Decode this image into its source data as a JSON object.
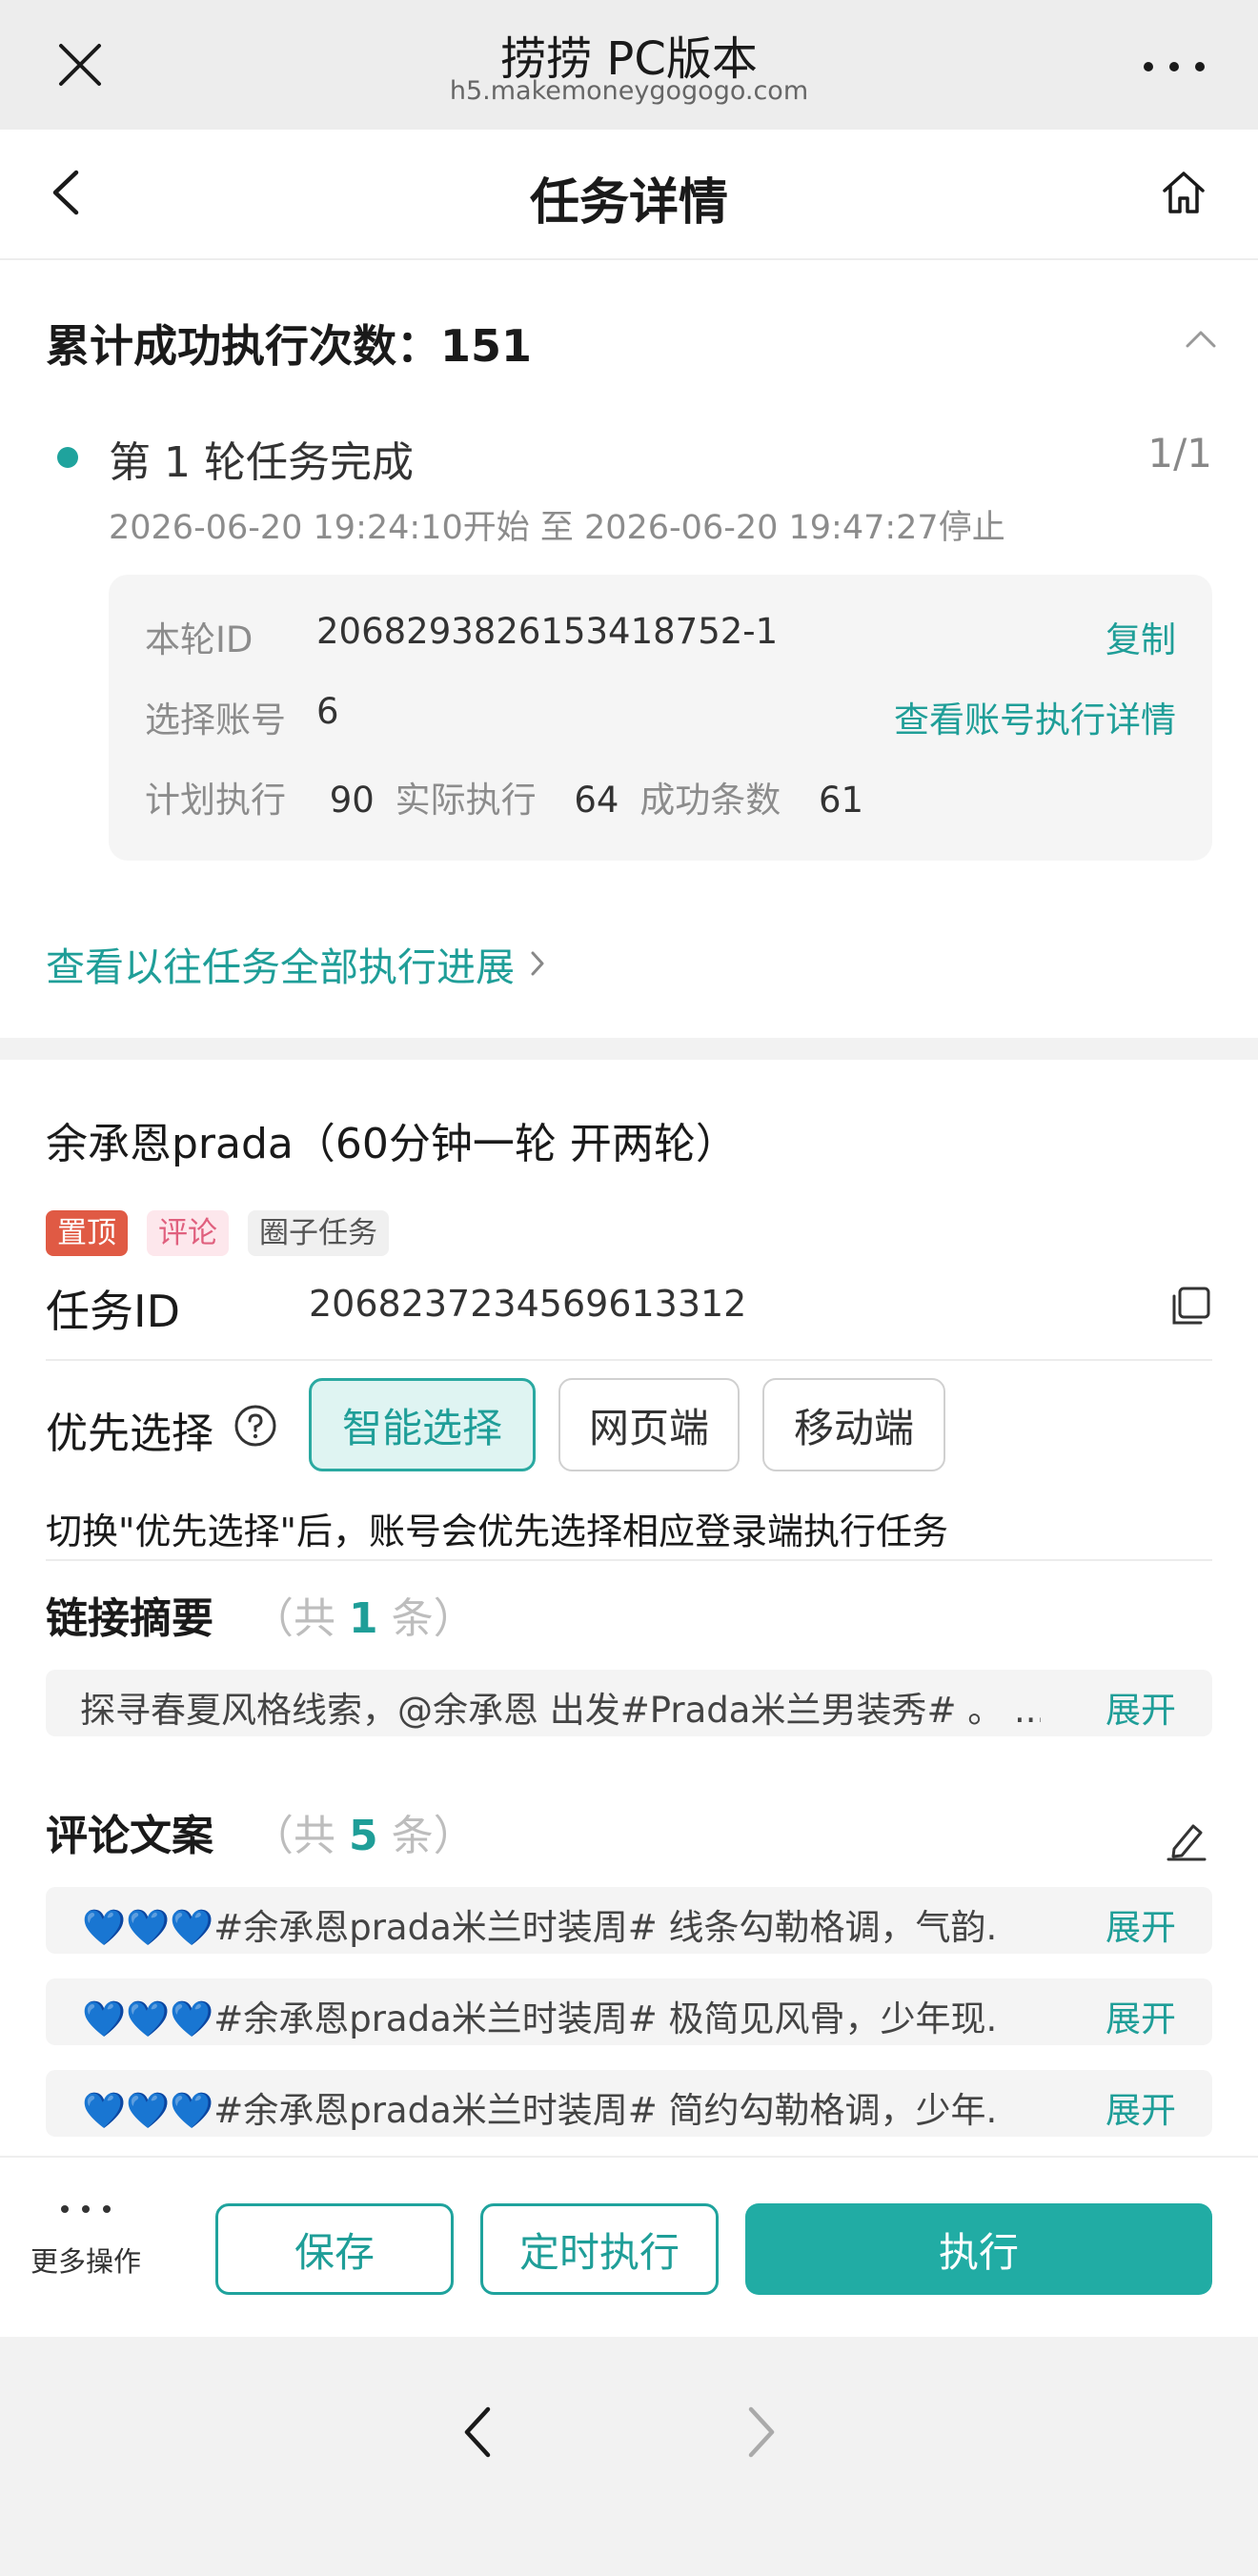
{
  "browser": {
    "title": "捞捞 PC版本",
    "url": "h5.makemoneygogogo.com"
  },
  "header": {
    "title": "任务详情"
  },
  "progress": {
    "total_label": "累计成功执行次数：151",
    "round_title": "第 1 轮任务完成",
    "round_count": "1/1",
    "round_time": "2026-06-20 19:24:10开始 至 2026-06-20 19:47:27停止",
    "card": {
      "round_id_label": "本轮ID",
      "round_id_value": "2068293826153418752-1",
      "copy_label": "复制",
      "accounts_label": "选择账号",
      "accounts_value": "6",
      "accounts_link": "查看账号执行详情",
      "planned_label": "计划执行",
      "planned_value": "90",
      "actual_label": "实际执行",
      "actual_value": "64",
      "success_label": "成功条数",
      "success_value": "61"
    },
    "history_link": "查看以往任务全部执行进展"
  },
  "task": {
    "name": "余承恩prada（60分钟一轮 开两轮）",
    "tags": [
      "置顶",
      "评论",
      "圈子任务"
    ],
    "id_label": "任务ID",
    "id_value": "2068237234569613312",
    "priority_label": "优先选择",
    "priority_options": [
      "智能选择",
      "网页端",
      "移动端"
    ],
    "priority_selected": "智能选择",
    "priority_hint": "切换\"优先选择\"后，账号会优先选择相应登录端执行任务",
    "links": {
      "title": "链接摘要",
      "count_prefix": "（共",
      "count": "1",
      "count_suffix": "条）",
      "items": [
        {
          "text": "探寻春夏风格线索，@余承恩 出发#Prada米兰男装秀# 。 ...",
          "more": "展开"
        }
      ]
    },
    "comments": {
      "title": "评论文案",
      "count_prefix": "（共",
      "count": "5",
      "count_suffix": "条）",
      "hearts": "💙💙💙",
      "items": [
        {
          "text": "#余承恩prada米兰时装周# 线条勾勒格调，气韵.",
          "more": "展开"
        },
        {
          "text": "#余承恩prada米兰时装周# 极简见风骨，少年现.",
          "more": "展开"
        },
        {
          "text": "#余承恩prada米兰时装周# 简约勾勒格调，少年.",
          "more": "展开"
        }
      ]
    }
  },
  "actions": {
    "more_label": "更多操作",
    "save_label": "保存",
    "timed_label": "定时执行",
    "execute_label": "执行"
  },
  "colors": {
    "accent": "#21aca4",
    "tag_top": "#e05a44",
    "tag_comment": "#e0607e"
  }
}
